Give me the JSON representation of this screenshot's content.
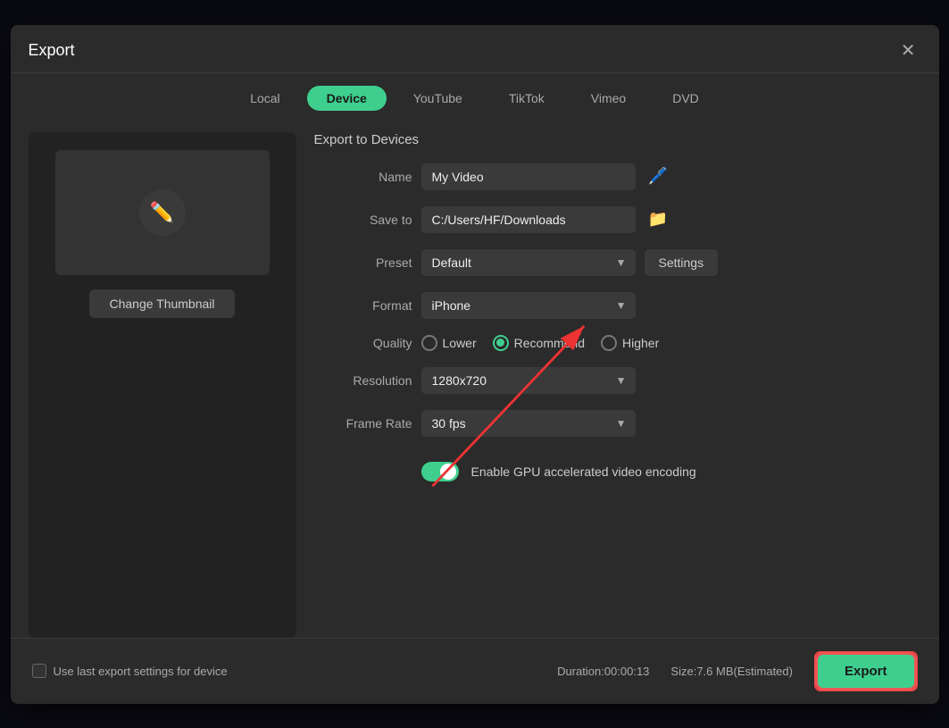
{
  "dialog": {
    "title": "Export",
    "close_label": "✕"
  },
  "tabs": [
    {
      "id": "local",
      "label": "Local",
      "active": false
    },
    {
      "id": "device",
      "label": "Device",
      "active": true
    },
    {
      "id": "youtube",
      "label": "YouTube",
      "active": false
    },
    {
      "id": "tiktok",
      "label": "TikTok",
      "active": false
    },
    {
      "id": "vimeo",
      "label": "Vimeo",
      "active": false
    },
    {
      "id": "dvd",
      "label": "DVD",
      "active": false
    }
  ],
  "thumbnail": {
    "change_label": "Change Thumbnail"
  },
  "form": {
    "section_title": "Export to Devices",
    "name_label": "Name",
    "name_value": "My Video",
    "save_to_label": "Save to",
    "save_to_value": "C:/Users/HF/Downloads",
    "preset_label": "Preset",
    "preset_value": "Default",
    "settings_label": "Settings",
    "format_label": "Format",
    "format_value": "iPhone",
    "quality_label": "Quality",
    "quality_options": [
      {
        "id": "lower",
        "label": "Lower",
        "checked": false
      },
      {
        "id": "recommend",
        "label": "Recommend",
        "checked": true
      },
      {
        "id": "higher",
        "label": "Higher",
        "checked": false
      }
    ],
    "resolution_label": "Resolution",
    "resolution_value": "1280x720",
    "frame_rate_label": "Frame Rate",
    "frame_rate_value": "30 fps",
    "gpu_label": "Enable GPU accelerated video encoding",
    "gpu_enabled": true
  },
  "footer": {
    "use_last_label": "Use last export settings for device",
    "duration_label": "Duration:",
    "duration_value": "00:00:13",
    "size_label": "Size:",
    "size_value": "7.6 MB(Estimated)",
    "export_label": "Export"
  }
}
